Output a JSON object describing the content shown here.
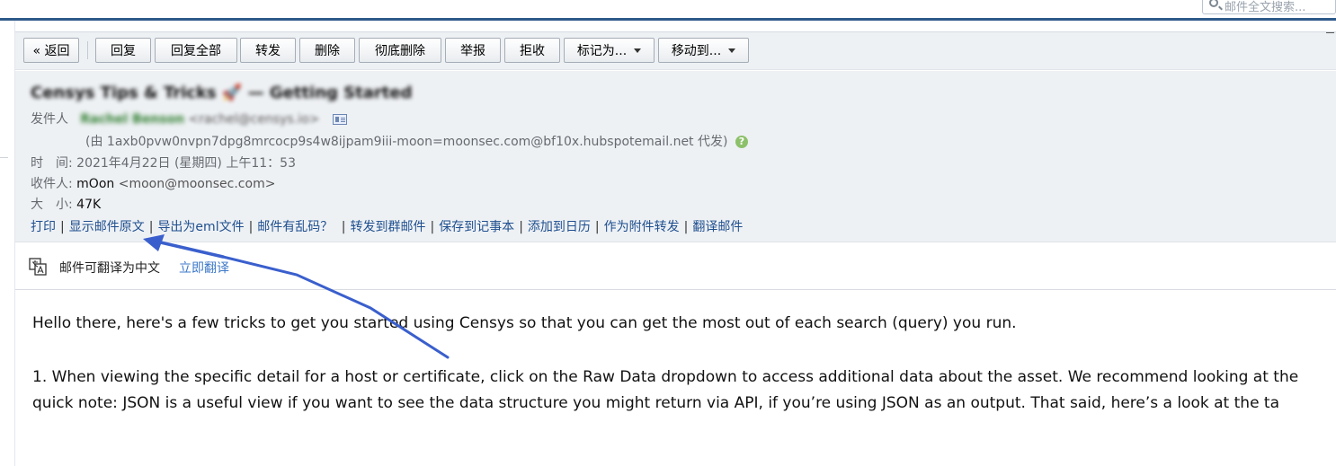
{
  "search": {
    "placeholder": "邮件全文搜索..."
  },
  "toolbar": {
    "back": "« 返回",
    "reply": "回复",
    "reply_all": "回复全部",
    "forward": "转发",
    "delete": "删除",
    "delete_forever": "彻底删除",
    "report": "举报",
    "reject": "拒收",
    "mark_as": "标记为...",
    "move_to": "移动到..."
  },
  "header": {
    "subject": "Censys Tips & Tricks 🚀 — Getting Started",
    "sender_label": "发件人",
    "sender_name": "Rachel Benson",
    "sender_email": "<rachel@censys.io>",
    "via_line": "(由 1axb0pvw0nvpn7dpg8mrcocp9s4w8ijpam9iii-moon=moonsec.com@bf10x.hubspotemail.net 代发)",
    "help_icon_glyph": "?",
    "time_label": "时　间:",
    "time_value": "2021年4月22日 (星期四) 上午11：53",
    "to_label": "收件人:",
    "to_name": "mOon",
    "to_email": "<moon@moonsec.com>",
    "size_label": "大　小:",
    "size_value": "47K"
  },
  "actions": [
    "打印",
    "显示邮件原文",
    "导出为eml文件",
    "邮件有乱码？",
    "转发到群邮件",
    "保存到记事本",
    "添加到日历",
    "作为附件转发",
    "翻译邮件"
  ],
  "translate": {
    "text": "邮件可翻译为中文",
    "link": "立即翻译"
  },
  "body": {
    "para1": "Hello there, here's a few tricks to get you started using Censys so that you can get the most out of each search (query) you run.",
    "para2_line1": "1. When viewing the specific detail for a host or certificate, click on the Raw Data dropdown to access additional data about the asset. We recommend looking at the",
    "para2_line2": "quick note: JSON is a useful view if you want to see the data structure you might return via API, if you’re using JSON as an output. That said, here’s a look at the ta"
  },
  "colors": {
    "link": "#1f4f8f",
    "accent_bar": "#2f5a8a",
    "annotation_arrow": "#3a5fcd",
    "panel_bg": "#eef1f4"
  }
}
